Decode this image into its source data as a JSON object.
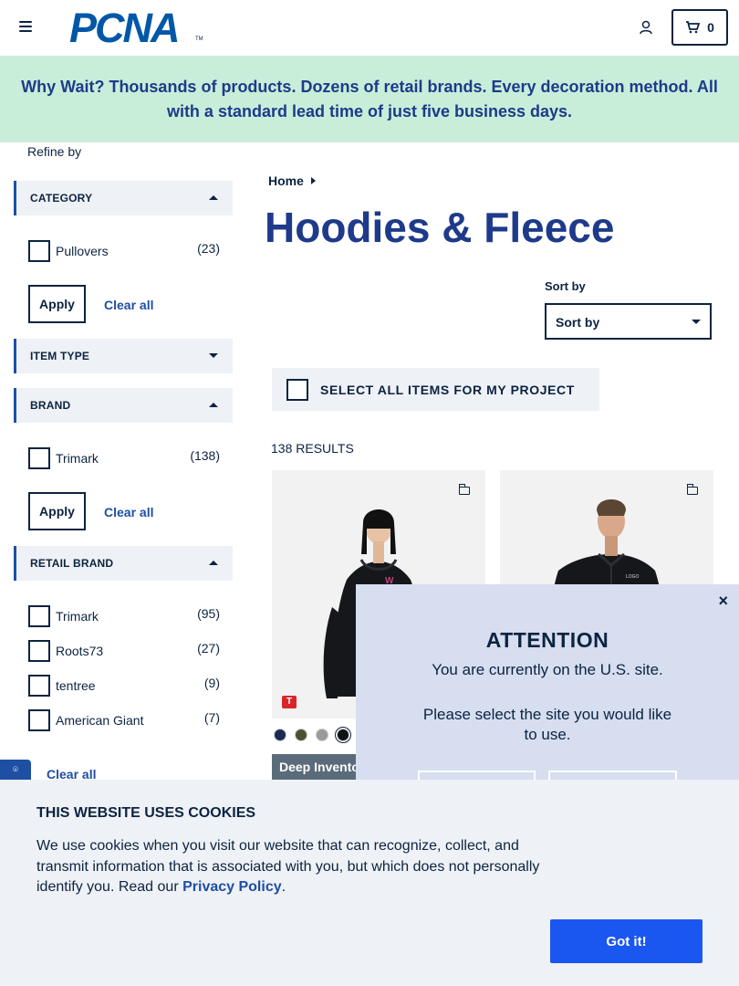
{
  "header": {
    "logo_text": "PCNA",
    "logo_tm": "TM",
    "cart_count": "0",
    "icons": [
      "menu-icon",
      "user-icon",
      "cart-icon"
    ]
  },
  "banner": {
    "text": "Why Wait? Thousands of products. Dozens of retail brands. Every decoration method. All with a standard lead time of just five business days."
  },
  "sidebar": {
    "refine_label": "Refine by",
    "category": {
      "title": "CATEGORY",
      "items": [
        {
          "label": "Pullovers",
          "count": "(23)"
        }
      ],
      "apply": "Apply",
      "clear": "Clear all"
    },
    "item_type": {
      "title": "ITEM TYPE"
    },
    "brand": {
      "title": "BRAND",
      "items": [
        {
          "label": "Trimark",
          "count": "(138)"
        }
      ],
      "apply": "Apply",
      "clear": "Clear all"
    },
    "retail_brand": {
      "title": "RETAIL BRAND",
      "items": [
        {
          "label": "Trimark",
          "count": "(95)"
        },
        {
          "label": "Roots73",
          "count": "(27)"
        },
        {
          "label": "tentree",
          "count": "(9)"
        },
        {
          "label": "American Giant",
          "count": "(7)"
        }
      ],
      "clear": "Clear all"
    }
  },
  "main": {
    "breadcrumb": "Home",
    "title": "Hoodies & Fleece",
    "sort_label": "Sort by",
    "sort_value": "Sort by",
    "select_all": "SELECT ALL ITEMS FOR MY PROJECT",
    "results": "138 RESULTS",
    "card1": {
      "badge": "T",
      "tag": "Deep Inventory",
      "swatches": [
        "#1b2a52",
        "#4a5230",
        "#9a9a9a",
        "#111111"
      ]
    },
    "card2": {}
  },
  "modal": {
    "title": "ATTENTION",
    "line1": "You are currently on the U.S. site.",
    "line2": "Please select the site you would like to use.",
    "close": "×"
  },
  "cookie": {
    "title": "THIS WEBSITE USES COOKIES",
    "body": "We use cookies when you visit our website that can recognize, collect, and transmit information that is associated with you, but which does not personally identify you. Read our ",
    "link": "Privacy Policy",
    "suffix": ".",
    "button": "Got it!"
  },
  "colors": {
    "primary": "#0c2340",
    "accent": "#1e4fa3",
    "banner_bg": "#c8eed9",
    "cookie_button": "#1a56f0"
  }
}
